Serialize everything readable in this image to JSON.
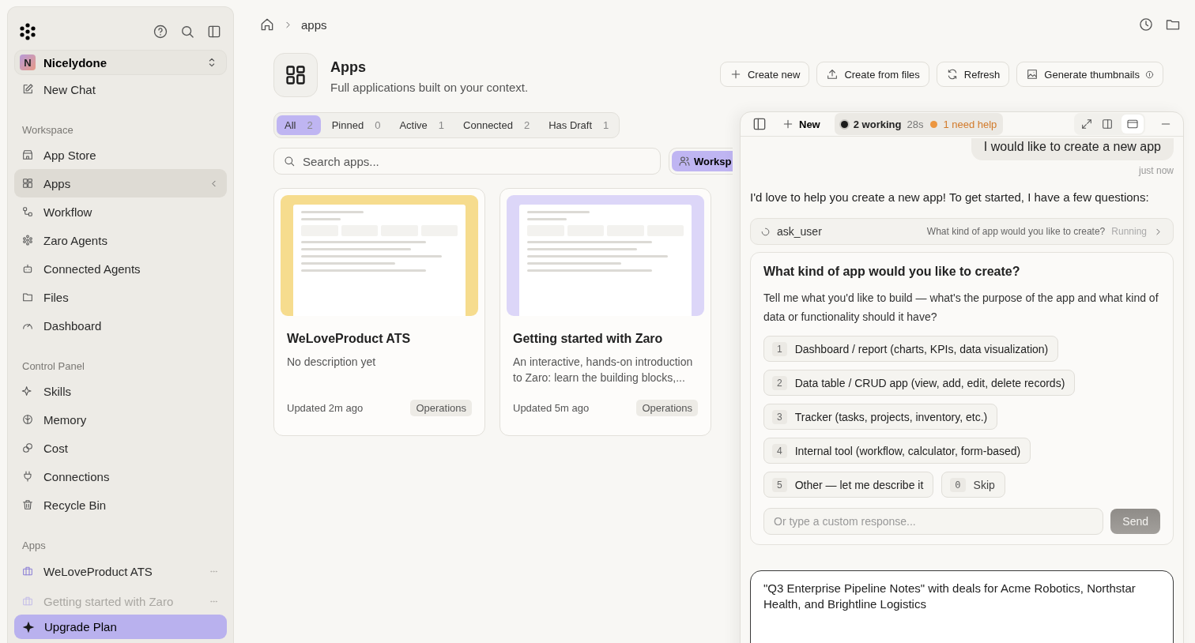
{
  "sidebar": {
    "workspace": {
      "initial": "N",
      "name": "Nicelydone"
    },
    "new_chat": "New Chat",
    "sections": [
      {
        "title": "Workspace",
        "items": [
          {
            "label": "App Store",
            "selected": false
          },
          {
            "label": "Apps",
            "selected": true
          },
          {
            "label": "Workflow",
            "selected": false
          },
          {
            "label": "Zaro Agents",
            "selected": false
          },
          {
            "label": "Connected Agents",
            "selected": false
          },
          {
            "label": "Files",
            "selected": false
          },
          {
            "label": "Dashboard",
            "selected": false
          }
        ]
      },
      {
        "title": "Control Panel",
        "items": [
          {
            "label": "Skills",
            "selected": false
          },
          {
            "label": "Memory",
            "selected": false
          },
          {
            "label": "Cost",
            "selected": false
          },
          {
            "label": "Connections",
            "selected": false
          },
          {
            "label": "Recycle Bin",
            "selected": false
          }
        ]
      }
    ],
    "apps_title": "Apps",
    "apps": [
      {
        "label": "WeLoveProduct ATS",
        "dimmed": false
      },
      {
        "label": "Getting started with Zaro",
        "dimmed": true
      }
    ],
    "upgrade": "Upgrade Plan"
  },
  "breadcrumb": "apps",
  "header": {
    "title": "Apps",
    "subtitle": "Full applications built on your context.",
    "buttons": [
      "Create new",
      "Create from files",
      "Refresh",
      "Generate thumbnails"
    ]
  },
  "filters": [
    {
      "label": "All",
      "count": "2",
      "selected": true
    },
    {
      "label": "Pinned",
      "count": "0",
      "selected": false
    },
    {
      "label": "Active",
      "count": "1",
      "selected": false
    },
    {
      "label": "Connected",
      "count": "2",
      "selected": false
    },
    {
      "label": "Has Draft",
      "count": "1",
      "selected": false
    }
  ],
  "search": {
    "placeholder": "Search apps..."
  },
  "scope_button": "Worksp",
  "cards": [
    {
      "title": "WeLoveProduct ATS",
      "description": "No description yet",
      "updated": "Updated 2m ago",
      "tag": "Operations",
      "color": "#f6dc8e"
    },
    {
      "title": "Getting started with Zaro",
      "description": "An interactive, hands-on introduction to Zaro: learn the building blocks,...",
      "updated": "Updated 5m ago",
      "tag": "Operations",
      "color": "#dcd6f8"
    }
  ],
  "chat": {
    "new": "New",
    "working": "2 working",
    "elapsed": "28s",
    "need_help": "1 need help",
    "user_message": "I would like to create a new app",
    "timestamp": "just now",
    "assistant_message": "I'd love to help you create a new app! To get started, I have a few questions:",
    "tool": {
      "name": "ask_user",
      "question": "What kind of app would you like to create?",
      "status": "Running"
    },
    "question": {
      "title": "What kind of app would you like to create?",
      "body": "Tell me what you'd like to build — what's the purpose of the app and what kind of data or functionality should it have?",
      "options": [
        {
          "key": "1",
          "label": "Dashboard / report (charts, KPIs, data visualization)"
        },
        {
          "key": "2",
          "label": "Data table / CRUD app (view, add, edit, delete records)"
        },
        {
          "key": "3",
          "label": "Tracker (tasks, projects, inventory, etc.)"
        },
        {
          "key": "4",
          "label": "Internal tool (workflow, calculator, form-based)"
        },
        {
          "key": "5",
          "label": "Other — let me describe it"
        }
      ],
      "skip": {
        "key": "0",
        "label": "Skip"
      },
      "placeholder": "Or type a custom response...",
      "send": "Send"
    },
    "composer": "\"Q3 Enterprise Pipeline Notes\" with deals for Acme Robotics, Northstar Health, and Brightline Logistics"
  }
}
